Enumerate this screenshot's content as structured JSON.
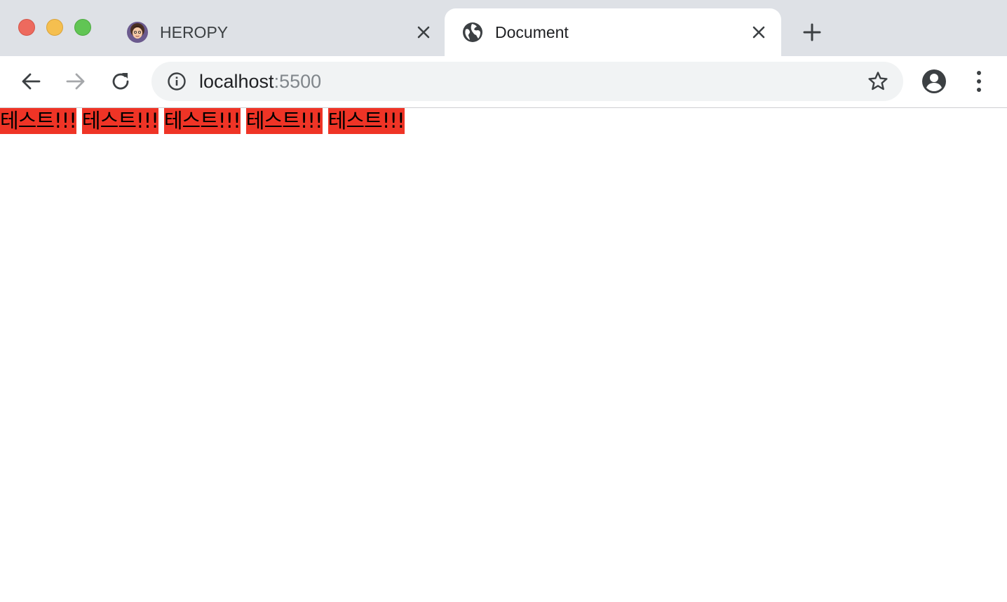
{
  "browser": {
    "tabs": [
      {
        "title": "HEROPY",
        "favicon": "avatar-favicon-icon",
        "active": false
      },
      {
        "title": "Document",
        "favicon": "globe-icon",
        "active": true
      }
    ],
    "address_bar": {
      "host": "localhost",
      "port": ":5500"
    },
    "colors": {
      "tabstrip": "#dee1e6",
      "omnibox": "#f1f3f4",
      "close_light": "#ed6a5e",
      "minimize_light": "#f5bf4f",
      "maximize_light": "#61c554"
    }
  },
  "page": {
    "items": [
      "테스트!!!",
      "테스트!!!",
      "테스트!!!",
      "테스트!!!",
      "테스트!!!"
    ],
    "item_background": "#ef3426"
  }
}
